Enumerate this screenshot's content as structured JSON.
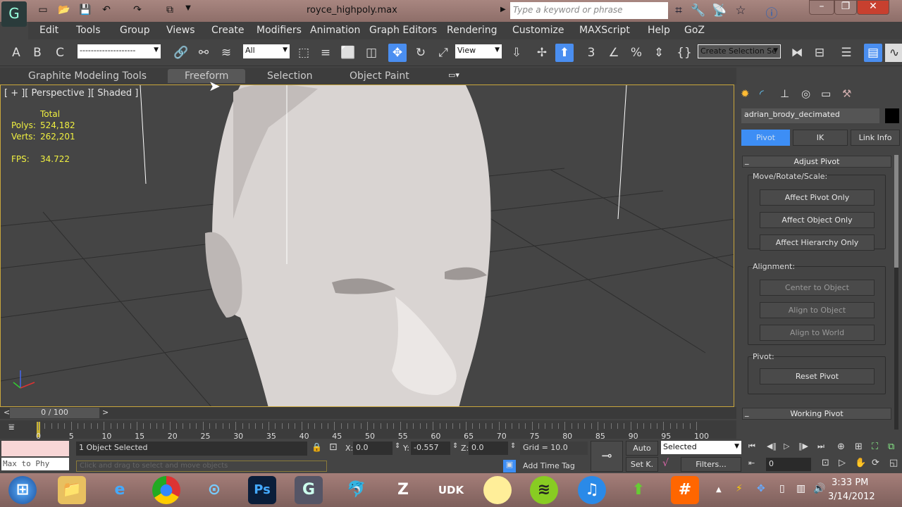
{
  "window": {
    "title": "royce_highpoly.max",
    "search_placeholder": "Type a keyword or phrase",
    "min": "–",
    "max": "❐",
    "close": "✕"
  },
  "menu": [
    "Edit",
    "Tools",
    "Group",
    "Views",
    "Create",
    "Modifiers",
    "Animation",
    "Graph Editors",
    "Rendering",
    "Customize",
    "MAXScript",
    "Help",
    "GoZ"
  ],
  "toolbar": {
    "named_set_line": "--------------------",
    "selection_filter": "All",
    "ref_coord": "View",
    "create_selection_set": "Create Selection Se",
    "accent": "#4a8ef0"
  },
  "ribbon": {
    "tabs": [
      "Graphite Modeling Tools",
      "Freeform",
      "Selection",
      "Object Paint"
    ],
    "active": "Freeform"
  },
  "viewport": {
    "label": "[ + ][ Perspective ][ Shaded ]",
    "stats_header": "Total",
    "polys_label": "Polys:",
    "polys": "524,182",
    "verts_label": "Verts:",
    "verts": "262,201",
    "fps_label": "FPS:",
    "fps": "34.722"
  },
  "cmdpanel": {
    "object_name": "adrian_brody_decimated",
    "tabs": [
      "Pivot",
      "IK",
      "Link Info"
    ],
    "active_tab": "Pivot",
    "adjust_pivot": "Adjust Pivot",
    "collapse": "_",
    "move_rotate_scale": "Move/Rotate/Scale:",
    "affect_pivot": "Affect Pivot Only",
    "affect_object": "Affect Object Only",
    "affect_hierarchy": "Affect Hierarchy Only",
    "alignment": "Alignment:",
    "center_to_object": "Center to Object",
    "align_to_object": "Align to Object",
    "align_to_world": "Align to World",
    "pivot": "Pivot:",
    "reset_pivot": "Reset Pivot",
    "working_pivot": "Working Pivot"
  },
  "timeline": {
    "frame": "0 / 100",
    "prev": "<",
    "next": ">",
    "ticks": [
      "0",
      "5",
      "10",
      "15",
      "20",
      "25",
      "30",
      "35",
      "40",
      "45",
      "50",
      "55",
      "60",
      "65",
      "70",
      "75",
      "80",
      "85",
      "90",
      "95",
      "100"
    ],
    "progress": 0
  },
  "status": {
    "maxscript": "Max to Phy",
    "selected": "1 Object Selected",
    "prompt": "Click and drag to select and move objects",
    "x_label": "X:",
    "x": "0.0",
    "y_label": "Y:",
    "y": "-0.557",
    "z_label": "Z:",
    "z": "0.0",
    "grid": "Grid = 10.0",
    "add_time_tag": "Add Time Tag",
    "auto": "Auto",
    "setk": "Set K.",
    "key_filter": "Selected",
    "filters": "Filters...",
    "current_frame": "0"
  },
  "taskbar": {
    "time": "3:33 PM",
    "date": "3/14/2012"
  }
}
